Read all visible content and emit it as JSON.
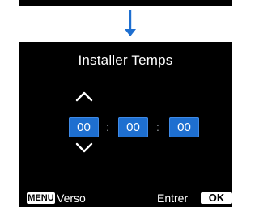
{
  "screen": {
    "title": "Installer Temps",
    "time": {
      "hours": "00",
      "minutes": "00",
      "seconds": "00"
    },
    "separator": ":",
    "footer": {
      "menu_key": "MENU",
      "menu_label": "Verso",
      "ok_key": "OK",
      "ok_label": "Entrer"
    }
  },
  "icons": [
    "arrow-down-icon",
    "chevron-up-icon",
    "chevron-down-icon"
  ],
  "colors": {
    "screen_bg": "#000000",
    "field_bg": "#1e6fd0",
    "arrow": "#1e6fd0"
  }
}
